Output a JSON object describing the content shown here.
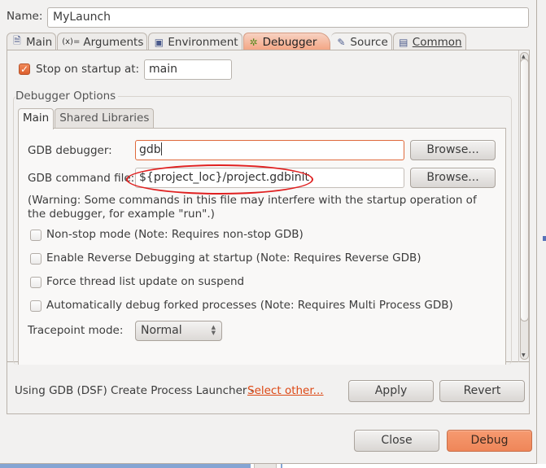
{
  "name": {
    "label": "Name:",
    "value": "MyLaunch"
  },
  "tabs": [
    {
      "label": "Main",
      "icon": "document-icon",
      "glyph": "🗎",
      "active": false
    },
    {
      "label": "Arguments",
      "icon": "variable-icon",
      "glyph": "(x)=",
      "active": false
    },
    {
      "label": "Environment",
      "icon": "environment-icon",
      "glyph": "▣",
      "active": false
    },
    {
      "label": "Debugger",
      "icon": "bug-icon",
      "glyph": "✲",
      "active": true
    },
    {
      "label": "Source",
      "icon": "source-icon",
      "glyph": "✎",
      "active": false
    },
    {
      "label": "Common",
      "icon": "table-icon",
      "glyph": "▤",
      "active": false
    }
  ],
  "stop_on_startup": {
    "label": "Stop on startup at:",
    "checked": true,
    "check_glyph": "✓",
    "value": "main"
  },
  "debugger_options": {
    "group_label": "Debugger Options",
    "tabs": [
      {
        "label": "Main",
        "active": true
      },
      {
        "label": "Shared Libraries",
        "active": false
      }
    ],
    "gdb_debugger": {
      "label": "GDB debugger:",
      "value": "gdb",
      "browse_label": "Browse..."
    },
    "gdb_command_file": {
      "label": "GDB command file:",
      "value": "${project_loc}/project.gdbinit",
      "browse_label": "Browse...",
      "highlighted": true
    },
    "warning": "(Warning: Some commands in this file may interfere with the startup operation of the debugger, for example \"run\".)",
    "options": [
      {
        "label": "Non-stop mode (Note: Requires non-stop GDB)",
        "checked": false
      },
      {
        "label": "Enable Reverse Debugging at startup (Note: Requires Reverse GDB)",
        "checked": false
      },
      {
        "label": "Force thread list update on suspend",
        "checked": false
      },
      {
        "label": "Automatically debug forked processes (Note: Requires Multi Process GDB)",
        "checked": false
      }
    ],
    "tracepoint_mode": {
      "label": "Tracepoint mode:",
      "value": "Normal"
    }
  },
  "scrollbar": {
    "up_glyph": "▲",
    "down_glyph": "▼"
  },
  "launcher": {
    "text": "Using GDB (DSF) Create Process Launcher -",
    "link": "Select other..."
  },
  "buttons": {
    "apply": "Apply",
    "revert": "Revert",
    "close": "Close",
    "debug": "Debug"
  },
  "colors": {
    "accent": "#ef8659",
    "link": "#dd4814",
    "annotation": "#e02020"
  }
}
